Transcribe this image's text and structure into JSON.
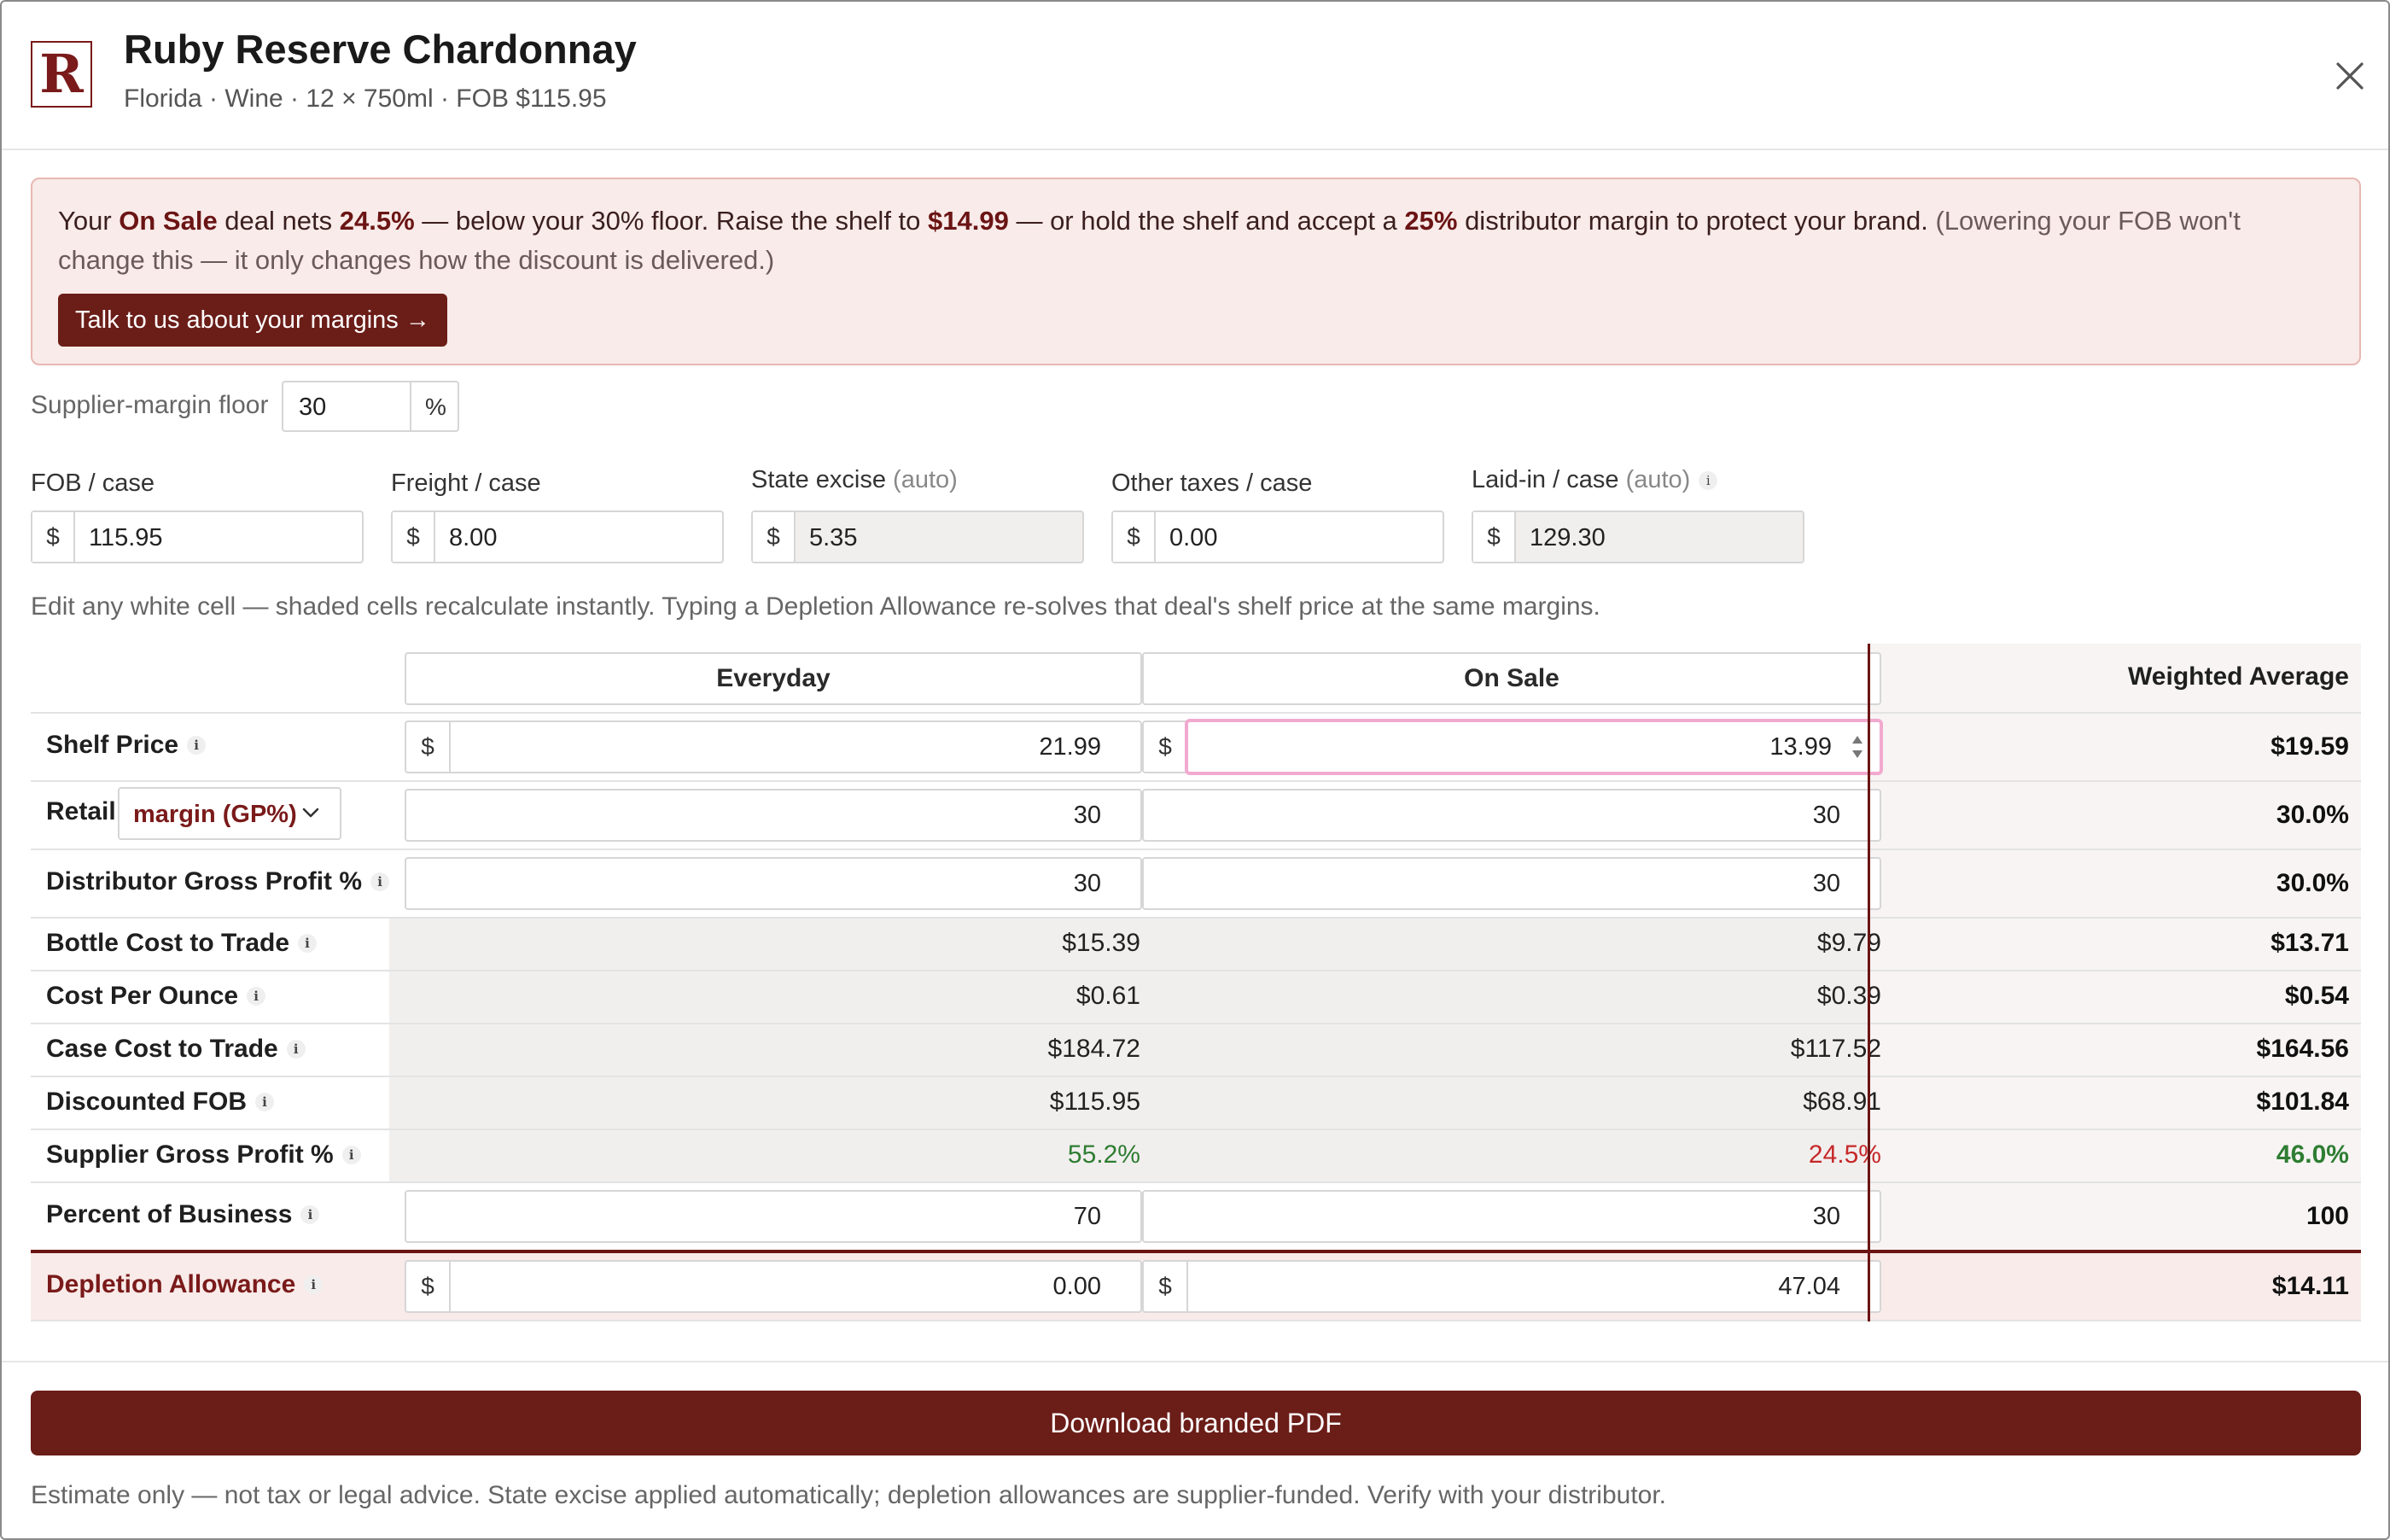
{
  "header": {
    "logo_letter": "R",
    "title": "Ruby Reserve Chardonnay",
    "subtitle": "Florida · Wine · 12 × 750ml · FOB $115.95",
    "close_icon": "close-icon"
  },
  "alert": {
    "t1": "Your ",
    "t2": "On Sale",
    "t3": " deal nets ",
    "t4": "24.5%",
    "t5": " — below your 30% floor. Raise the shelf to ",
    "t6": "$14.99",
    "t7": " — or hold the shelf and accept a ",
    "t8": "25%",
    "t9": " distributor margin to protect your brand. ",
    "t10": "(Lowering your FOB won't change this — it only changes how the discount is delivered.)",
    "button": "Talk to us about your margins →",
    "bg_color": "#f8ebe9",
    "accent_color": "#6b1d18"
  },
  "floor": {
    "label": "Supplier-margin floor",
    "value": "30",
    "unit": "%"
  },
  "costs": {
    "fob": {
      "label": "FOB / case",
      "currency": "$",
      "value": "115.95"
    },
    "freight": {
      "label": "Freight / case",
      "currency": "$",
      "value": "8.00"
    },
    "excise": {
      "label": "State excise",
      "auto": "(auto)",
      "currency": "$",
      "value": "5.35"
    },
    "other": {
      "label": "Other taxes / case",
      "currency": "$",
      "value": "0.00"
    },
    "laidin": {
      "label": "Laid-in / case",
      "auto": "(auto)",
      "currency": "$",
      "value": "129.30"
    }
  },
  "hint": "Edit any white cell — shaded cells recalculate instantly. Typing a Depletion Allowance re-solves that deal's shelf price at the same margins.",
  "table": {
    "col_everyday": "Everyday",
    "col_onsale": "On Sale",
    "col_weighted": "Weighted Average",
    "info_glyph": "i",
    "currency": "$",
    "retail_select": "margin (GP%)",
    "rows": {
      "shelf": {
        "label": "Shelf Price",
        "everyday": "21.99",
        "onsale": "13.99",
        "weighted": "$19.59"
      },
      "retail": {
        "label": "Retail",
        "everyday": "30",
        "onsale": "30",
        "weighted": "30.0%"
      },
      "dist": {
        "label": "Distributor Gross Profit %",
        "everyday": "30",
        "onsale": "30",
        "weighted": "30.0%"
      },
      "bottle": {
        "label": "Bottle Cost to Trade",
        "everyday": "$15.39",
        "onsale": "$9.79",
        "weighted": "$13.71"
      },
      "ounce": {
        "label": "Cost Per Ounce",
        "everyday": "$0.61",
        "onsale": "$0.39",
        "weighted": "$0.54"
      },
      "case": {
        "label": "Case Cost to Trade",
        "everyday": "$184.72",
        "onsale": "$117.52",
        "weighted": "$164.56"
      },
      "fob": {
        "label": "Discounted FOB",
        "everyday": "$115.95",
        "onsale": "$68.91",
        "weighted": "$101.84"
      },
      "supplier": {
        "label": "Supplier Gross Profit %",
        "everyday": "55.2%",
        "onsale": "24.5%",
        "weighted": "46.0%"
      },
      "business": {
        "label": "Percent of Business",
        "everyday": "70",
        "onsale": "30",
        "weighted": "100"
      },
      "depletion": {
        "label": "Depletion Allowance",
        "everyday": "0.00",
        "onsale": "47.04",
        "weighted": "$14.11"
      }
    },
    "good_color": "#2e7d32",
    "bad_color": "#c62828"
  },
  "footer": {
    "pdf_button": "Download branded PDF",
    "disclaimer": "Estimate only — not tax or legal advice. State excise applied automatically; depletion allowances are supplier-funded. Verify with your distributor."
  }
}
